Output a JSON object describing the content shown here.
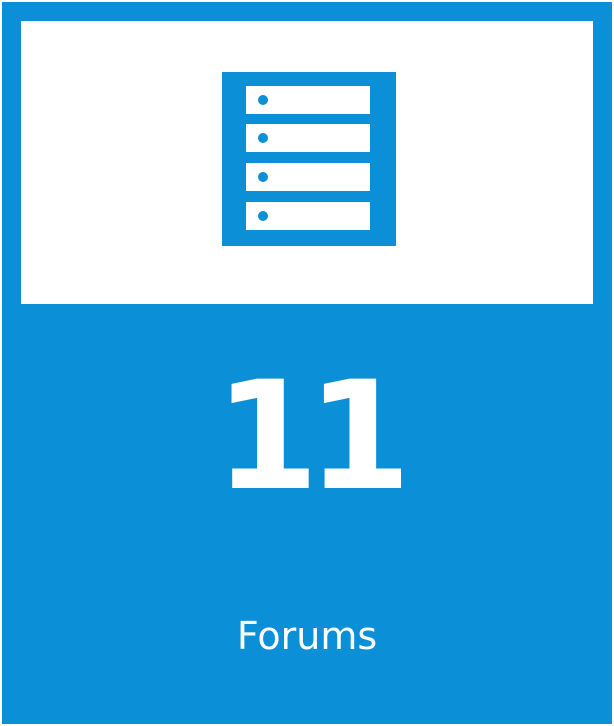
{
  "tile": {
    "icon": "forum-list-icon",
    "count": "11",
    "label": "Forums"
  },
  "colors": {
    "accent": "#0b8fd6",
    "panel": "#ffffff"
  }
}
